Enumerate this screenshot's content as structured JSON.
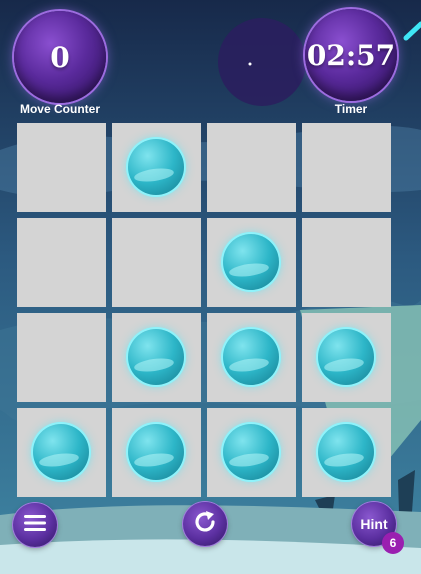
{
  "hud": {
    "moves": {
      "value": "0",
      "label": "Move Counter"
    },
    "timer": {
      "value": "02:57",
      "label": "Timer"
    }
  },
  "board": {
    "rows": 4,
    "cols": 4,
    "balls": [
      [
        false,
        true,
        false,
        false
      ],
      [
        false,
        false,
        true,
        false
      ],
      [
        false,
        true,
        true,
        true
      ],
      [
        true,
        true,
        true,
        true
      ]
    ]
  },
  "controls": {
    "hint_label": "Hint",
    "hint_count": "6",
    "menu_icon": "hamburger-menu-icon",
    "restart_icon": "restart-icon"
  },
  "colors": {
    "ball": "#2db6c8",
    "cell": "#d4d4d4",
    "orb": "#5a2a9c",
    "badge": "#9a1fb0"
  }
}
